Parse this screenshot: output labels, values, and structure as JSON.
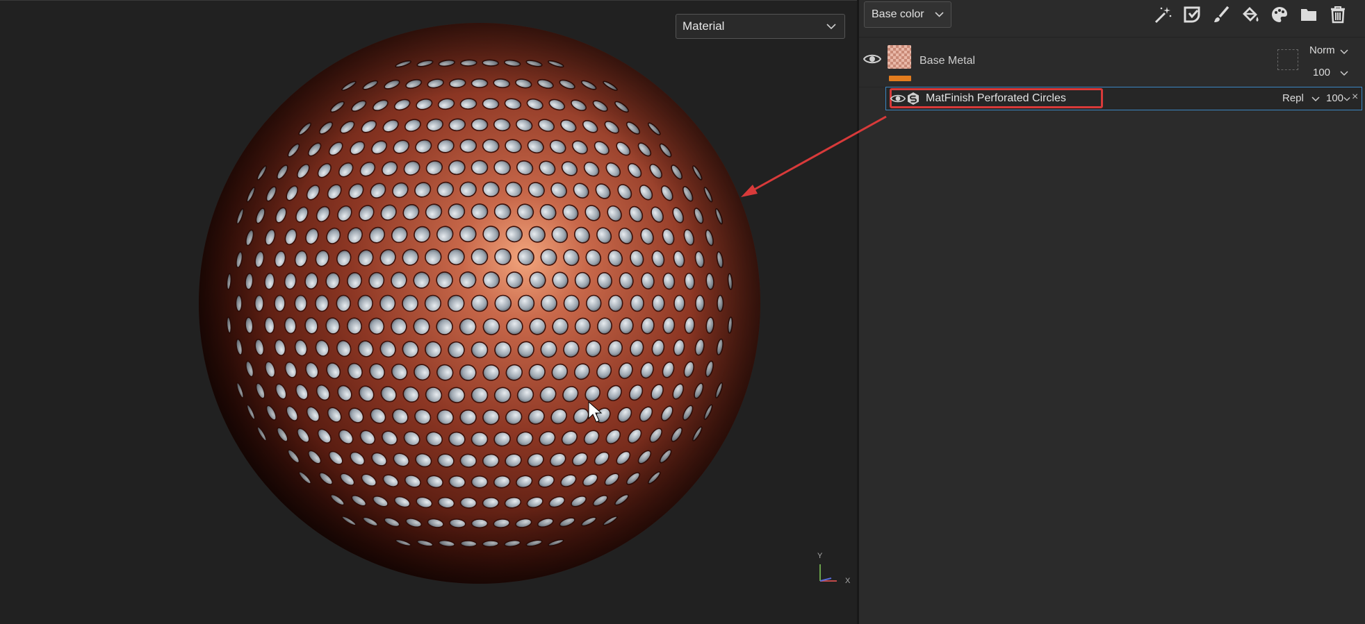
{
  "viewport": {
    "display_mode": "Material"
  },
  "axis_gizmo": {
    "y_label": "Y",
    "x_label": "X"
  },
  "layers_panel": {
    "channel": "Base color",
    "toolbar_icons": [
      "magic-wand-icon",
      "smart-mask-icon",
      "paint-brush-icon",
      "fill-bucket-icon",
      "palette-icon",
      "folder-icon",
      "trash-icon"
    ],
    "layers": [
      {
        "name": "Base Metal",
        "blend_mode": "Norm",
        "opacity": "100",
        "color_tag": "#e37c1e"
      }
    ],
    "effects": [
      {
        "name": "MatFinish Perforated Circles",
        "blend_mode": "Repl",
        "opacity": "100"
      }
    ]
  },
  "colors": {
    "accent_blue": "#3b87c4",
    "highlight_red": "#d83a3a",
    "tag_orange": "#e37c1e",
    "sphere_copper": "#8a3422"
  }
}
